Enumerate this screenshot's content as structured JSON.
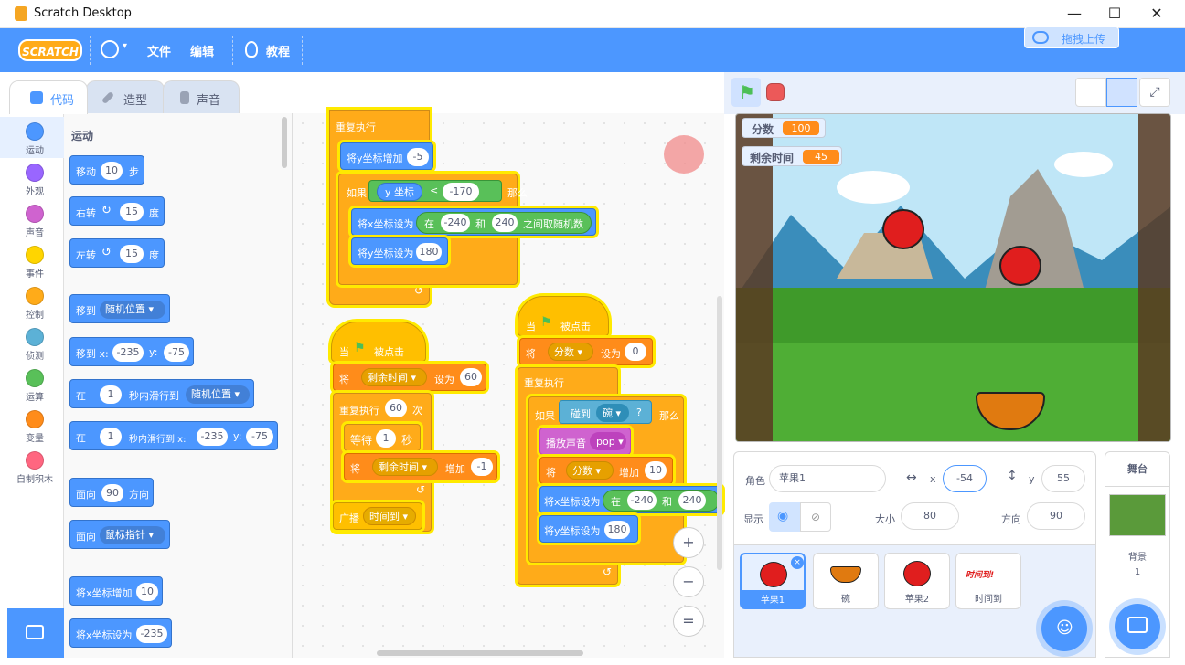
{
  "window": {
    "title": "Scratch Desktop"
  },
  "menu": {
    "file": "文件",
    "edit": "编辑",
    "tutorials": "教程",
    "logo": "SCRATCH",
    "upload": "拖拽上传"
  },
  "tabs": [
    {
      "label": "代码"
    },
    {
      "label": "造型"
    },
    {
      "label": "声音"
    }
  ],
  "categories": [
    {
      "label": "运动",
      "color": "#4c97ff"
    },
    {
      "label": "外观",
      "color": "#9966ff"
    },
    {
      "label": "声音",
      "color": "#cf63cf"
    },
    {
      "label": "事件",
      "color": "#ffd500"
    },
    {
      "label": "控制",
      "color": "#ffab19"
    },
    {
      "label": "侦测",
      "color": "#5cb1d6"
    },
    {
      "label": "运算",
      "color": "#59c059"
    },
    {
      "label": "变量",
      "color": "#ff8c1a"
    },
    {
      "label": "自制积木",
      "color": "#ff6680"
    }
  ],
  "palette": {
    "title": "运动",
    "move": {
      "a": "移动",
      "v": "10",
      "b": "步"
    },
    "turn_right": {
      "a": "右转",
      "v": "15",
      "b": "度"
    },
    "turn_left": {
      "a": "左转",
      "v": "15",
      "b": "度"
    },
    "goto": {
      "a": "移到",
      "v": "随机位置"
    },
    "goto_xy": {
      "a": "移到 x:",
      "x": "-235",
      "yl": "y:",
      "y": "-75"
    },
    "glide": {
      "a": "在",
      "v": "1",
      "b": "秒内滑行到",
      "d": "随机位置"
    },
    "glide_xy": {
      "a": "在",
      "v": "1",
      "b": "秒内滑行到 x:",
      "x": "-235",
      "yl": "y:",
      "y": "-75"
    },
    "direction": {
      "a": "面向",
      "v": "90",
      "b": "方向"
    },
    "point_to": {
      "a": "面向",
      "v": "鼠标指针"
    },
    "change_x": {
      "a": "将x坐标增加",
      "v": "10"
    },
    "set_x": {
      "a": "将x坐标设为",
      "v": "-235"
    }
  },
  "script1": {
    "forever": "重复执行",
    "change_y": {
      "a": "将y坐标增加",
      "v": "-5"
    },
    "if": {
      "a": "如果",
      "rep": "y 坐标",
      "op": "<",
      "v": "-170",
      "b": "那么"
    },
    "set_x": {
      "a": "将x坐标设为",
      "in": "在",
      "lo": "-240",
      "and": "和",
      "hi": "240",
      "b": "之间取随机数"
    },
    "set_y": {
      "a": "将y坐标设为",
      "v": "180"
    }
  },
  "script2": {
    "hat": {
      "a": "当",
      "b": "被点击"
    },
    "set_var": {
      "a": "将",
      "var": "剩余时间",
      "b": "设为",
      "v": "60"
    },
    "repeat": {
      "a": "重复执行",
      "v": "60",
      "b": "次"
    },
    "wait": {
      "a": "等待",
      "v": "1",
      "b": "秒"
    },
    "change_var": {
      "a": "将",
      "var": "剩余时间",
      "b": "增加",
      "v": "-1"
    },
    "broadcast": {
      "a": "广播",
      "v": "时间到"
    }
  },
  "script3": {
    "hat": {
      "a": "当",
      "b": "被点击"
    },
    "set_var": {
      "a": "将",
      "var": "分数",
      "b": "设为",
      "v": "0"
    },
    "forever": "重复执行",
    "if": {
      "a": "如果",
      "sense": "碰到",
      "obj": "碗",
      "q": "?",
      "b": "那么"
    },
    "sound": {
      "a": "播放声音",
      "v": "pop"
    },
    "change_var": {
      "a": "将",
      "var": "分数",
      "b": "增加",
      "v": "10"
    },
    "set_x": {
      "a": "将x坐标设为",
      "in": "在",
      "lo": "-240",
      "and": "和",
      "hi": "240"
    },
    "set_y": {
      "a": "将y坐标设为",
      "v": "180"
    }
  },
  "zoom": {
    "in": "+",
    "out": "−",
    "reset": "="
  },
  "monitors": {
    "score": {
      "label": "分数",
      "value": "100"
    },
    "time": {
      "label": "剩余时间",
      "value": "45"
    }
  },
  "sprite_info": {
    "sprite_label": "角色",
    "name": "苹果1",
    "x_label": "x",
    "x": "-54",
    "y_label": "y",
    "y": "55",
    "show_label": "显示",
    "size_label": "大小",
    "size": "80",
    "dir_label": "方向",
    "dir": "90"
  },
  "sprites": [
    {
      "name": "苹果1"
    },
    {
      "name": "碗"
    },
    {
      "name": "苹果2"
    },
    {
      "name": "时间到"
    }
  ],
  "time_up_costume": "时间到!",
  "stage_panel": {
    "title": "舞台",
    "backdrop_label": "背景",
    "backdrop_count": "1"
  }
}
